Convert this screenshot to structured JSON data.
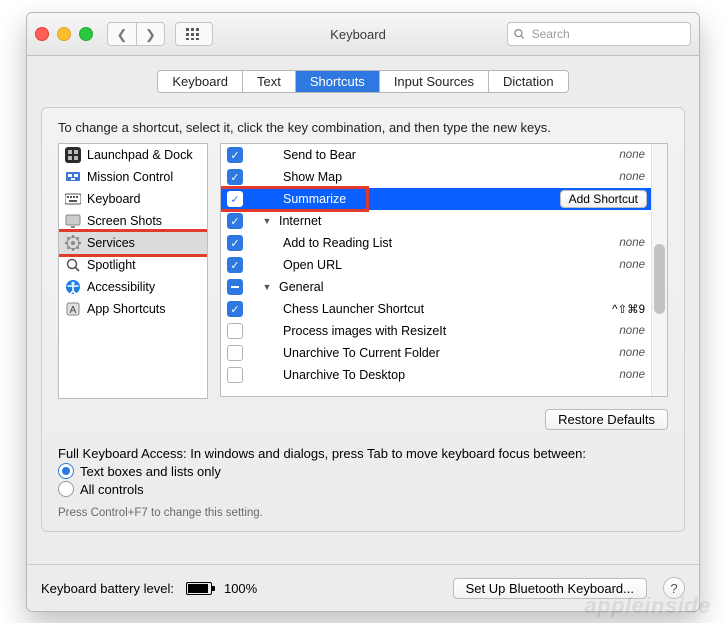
{
  "window": {
    "title": "Keyboard",
    "search_placeholder": "Search"
  },
  "tabs": {
    "items": [
      {
        "label": "Keyboard",
        "selected": false
      },
      {
        "label": "Text",
        "selected": false
      },
      {
        "label": "Shortcuts",
        "selected": true
      },
      {
        "label": "Input Sources",
        "selected": false
      },
      {
        "label": "Dictation",
        "selected": false
      }
    ]
  },
  "panel": {
    "instructions": "To change a shortcut, select it, click the key combination, and then type the new keys.",
    "restore_label": "Restore Defaults"
  },
  "categories": [
    {
      "label": "Launchpad & Dock",
      "icon": "launchpad"
    },
    {
      "label": "Mission Control",
      "icon": "mission"
    },
    {
      "label": "Keyboard",
      "icon": "keyboard"
    },
    {
      "label": "Screen Shots",
      "icon": "screenshots"
    },
    {
      "label": "Services",
      "icon": "services",
      "selected": true,
      "highlight": true
    },
    {
      "label": "Spotlight",
      "icon": "spotlight"
    },
    {
      "label": "Accessibility",
      "icon": "accessibility"
    },
    {
      "label": "App Shortcuts",
      "icon": "appshortcuts"
    }
  ],
  "services": [
    {
      "type": "item",
      "checked": true,
      "label": "Send to Bear",
      "shortcut": "none"
    },
    {
      "type": "item",
      "checked": true,
      "label": "Show Map",
      "shortcut": "none"
    },
    {
      "type": "item",
      "checked": true,
      "label": "Summarize",
      "shortcut_button": "Add Shortcut",
      "selected": true,
      "highlight": true
    },
    {
      "type": "group",
      "checked": true,
      "label": "Internet"
    },
    {
      "type": "item",
      "checked": true,
      "label": "Add to Reading List",
      "shortcut": "none"
    },
    {
      "type": "item",
      "checked": true,
      "label": "Open URL",
      "shortcut": "none"
    },
    {
      "type": "group",
      "checked": "mixed",
      "label": "General"
    },
    {
      "type": "item",
      "checked": true,
      "label": "Chess Launcher Shortcut",
      "shortcut": "^⇧⌘9",
      "shortcut_real": true
    },
    {
      "type": "item",
      "checked": false,
      "label": "Process images with ResizeIt",
      "shortcut": "none"
    },
    {
      "type": "item",
      "checked": false,
      "label": "Unarchive To Current Folder",
      "shortcut": "none"
    },
    {
      "type": "item",
      "checked": false,
      "label": "Unarchive To Desktop",
      "shortcut": "none"
    }
  ],
  "fka": {
    "prompt": "Full Keyboard Access: In windows and dialogs, press Tab to move keyboard focus between:",
    "opt1": "Text boxes and lists only",
    "opt2": "All controls",
    "selected": 0,
    "hint": "Press Control+F7 to change this setting."
  },
  "footer": {
    "battery_label": "Keyboard battery level:",
    "battery_pct": "100%",
    "bt_button": "Set Up Bluetooth Keyboard..."
  },
  "watermark": "appleinside"
}
